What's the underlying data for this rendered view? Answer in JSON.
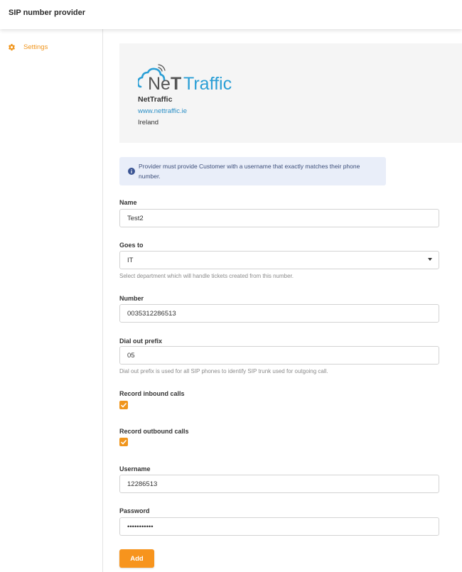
{
  "header": {
    "title": "SIP number provider"
  },
  "sidebar": {
    "items": [
      {
        "label": "Settings",
        "icon": "gear-icon"
      }
    ]
  },
  "provider": {
    "logo_text_prefix": "Ne",
    "logo_text_accent": "Traffic",
    "logo_text_T": "T",
    "name": "NetTraffic",
    "website": "www.nettraffic.ie",
    "country": "Ireland"
  },
  "notice": {
    "text": "Provider must provide Customer with a username that exactly matches their phone number.",
    "icon": "info-icon"
  },
  "form": {
    "name": {
      "label": "Name",
      "value": "Test2"
    },
    "goes_to": {
      "label": "Goes to",
      "value": "IT",
      "help": "Select department which will handle tickets created from this number."
    },
    "number": {
      "label": "Number",
      "value": "0035312286513"
    },
    "dial_out_prefix": {
      "label": "Dial out prefix",
      "value": "05",
      "help": "Dial out prefix is used for all SIP phones to identify SIP trunk used for outgoing call."
    },
    "record_inbound": {
      "label": "Record inbound calls",
      "checked": true
    },
    "record_outbound": {
      "label": "Record outbound calls",
      "checked": true
    },
    "username": {
      "label": "Username",
      "value": "12286513"
    },
    "password": {
      "label": "Password",
      "value": "•••••••••••"
    },
    "submit_label": "Add"
  },
  "colors": {
    "accent": "#f7941d",
    "link": "#2b8fc6",
    "notice_bg": "#e9eef9"
  }
}
